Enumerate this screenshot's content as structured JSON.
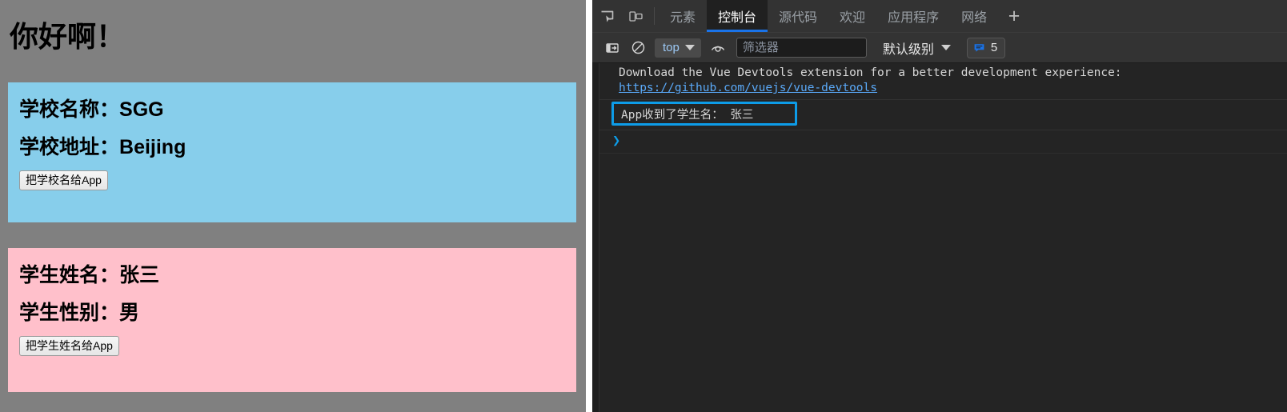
{
  "page": {
    "title": "你好啊！",
    "school_card": {
      "name_label": "学校名称：",
      "name_value": "SGG",
      "address_label": "学校地址：",
      "address_value": "Beijing",
      "button_label": "把学校名给App",
      "bg_color": "#87ceeb"
    },
    "student_card": {
      "name_label": "学生姓名：",
      "name_value": "张三",
      "gender_label": "学生性别：",
      "gender_value": "男",
      "button_label": "把学生姓名给App",
      "bg_color": "#ffc0cb"
    },
    "bg_color": "#808080"
  },
  "devtools": {
    "tabbar": {
      "inspect_icon": "inspect-element-icon",
      "device_icon": "device-toolbar-icon",
      "tabs": [
        {
          "label": "元素",
          "active": false
        },
        {
          "label": "控制台",
          "active": true
        },
        {
          "label": "源代码",
          "active": false
        },
        {
          "label": "欢迎",
          "active": false
        },
        {
          "label": "应用程序",
          "active": false
        },
        {
          "label": "网络",
          "active": false
        }
      ],
      "add_label": "+",
      "active_underline_color": "#1a73e8"
    },
    "toolbar": {
      "sidebar_icon": "console-sidebar-icon",
      "clear_icon": "clear-console-icon",
      "context_value": "top",
      "eye_icon": "live-expression-icon",
      "filter_placeholder": "筛选器",
      "filter_value": "",
      "level_value": "默认级别",
      "badge_icon": "message-bubble-icon",
      "badge_count": "5",
      "badge_color": "#1a73e8"
    },
    "console": {
      "messages": [
        {
          "text": "Download the Vue Devtools extension for a better development experience:",
          "link": "https://github.com/vuejs/vue-devtools"
        }
      ],
      "focused_message": "App收到了学生名： 张三",
      "focus_border_color": "#0d9ce8",
      "prompt_symbol": "❯"
    }
  }
}
